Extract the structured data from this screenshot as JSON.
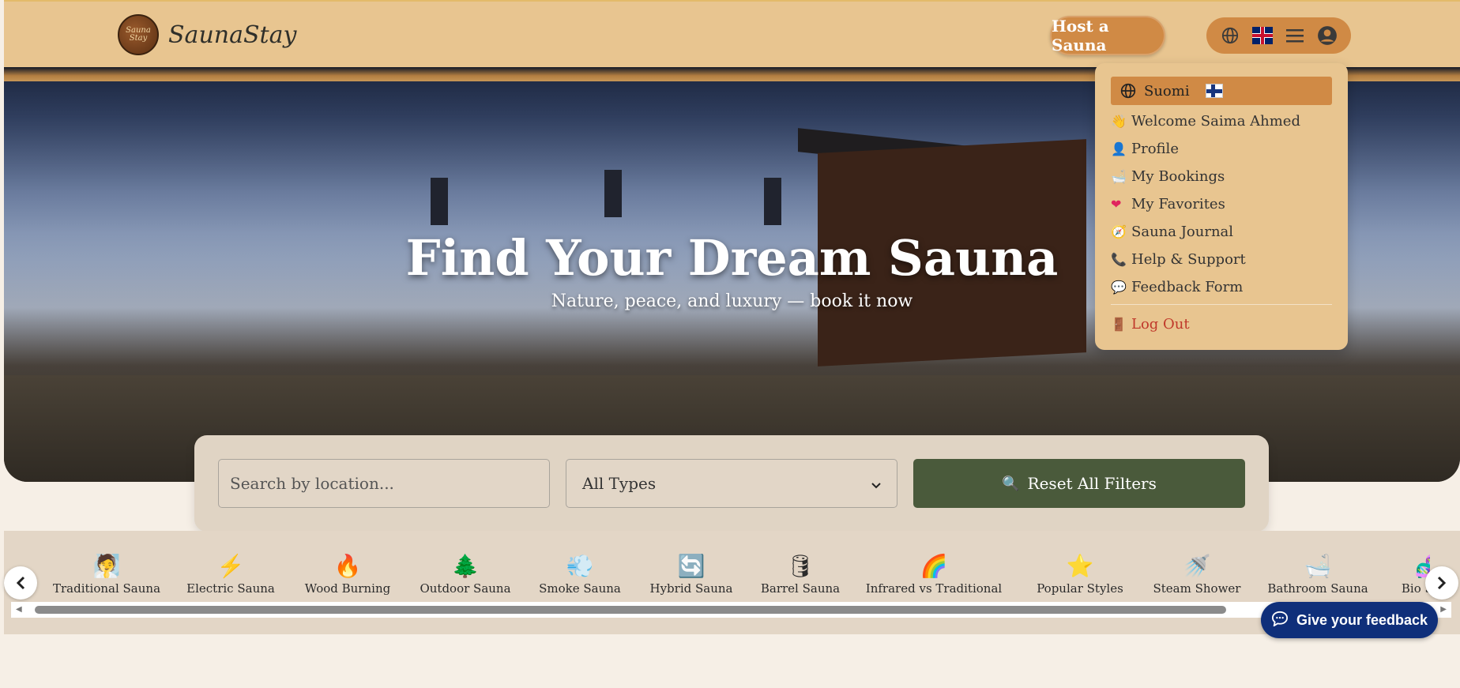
{
  "header": {
    "logo_badge_text": "Sauna Stay",
    "logo_text": "SaunaStay",
    "host_label": "Host a Sauna",
    "icons": [
      "globe-icon",
      "flag-uk-icon",
      "hamburger-menu-icon",
      "user-avatar-icon"
    ]
  },
  "hero": {
    "title": "Find Your Dream Sauna",
    "subtitle": "Nature, peace, and luxury — book it now"
  },
  "search": {
    "location_placeholder": "Search by location...",
    "type_selected": "All Types",
    "reset_label": "Reset All Filters",
    "reset_icon": "🔍"
  },
  "categories": [
    {
      "icon": "🧖",
      "label": "Traditional Sauna"
    },
    {
      "icon": "⚡",
      "label": "Electric Sauna"
    },
    {
      "icon": "🔥",
      "label": "Wood Burning"
    },
    {
      "icon": "🌲",
      "label": "Outdoor Sauna"
    },
    {
      "icon": "💨",
      "label": "Smoke Sauna"
    },
    {
      "icon": "🔄",
      "label": "Hybrid Sauna"
    },
    {
      "icon": "🛢",
      "label": "Barrel Sauna"
    },
    {
      "icon": "🌈",
      "label": "Infrared vs Traditional"
    },
    {
      "icon": "⭐",
      "label": "Popular Styles"
    },
    {
      "icon": "🚿",
      "label": "Steam Shower"
    },
    {
      "icon": "🛁",
      "label": "Bathroom Sauna"
    },
    {
      "icon": "🧬",
      "label": "Bio Saun"
    }
  ],
  "feedback": {
    "label": "Give your feedback"
  },
  "dropdown": {
    "language": "Suomi",
    "items": [
      {
        "icon": "👋",
        "label": "Welcome Saima Ahmed"
      },
      {
        "icon": "👤",
        "label": "Profile"
      },
      {
        "icon": "🛁",
        "label": "My Bookings"
      },
      {
        "icon": "❤",
        "label": "My Favorites"
      },
      {
        "icon": "🧭",
        "label": "Sauna Journal"
      },
      {
        "icon": "📞",
        "label": "Help & Support"
      },
      {
        "icon": "💬",
        "label": "Feedback Form"
      }
    ],
    "logout": {
      "icon": "🚪",
      "label": "Log Out"
    }
  },
  "colors": {
    "header_bg": "#e8c590",
    "accent": "#d08a45",
    "reset_btn": "#4a5a3b",
    "feedback_btn": "#0f2f7a",
    "logout": "#c0392b"
  }
}
